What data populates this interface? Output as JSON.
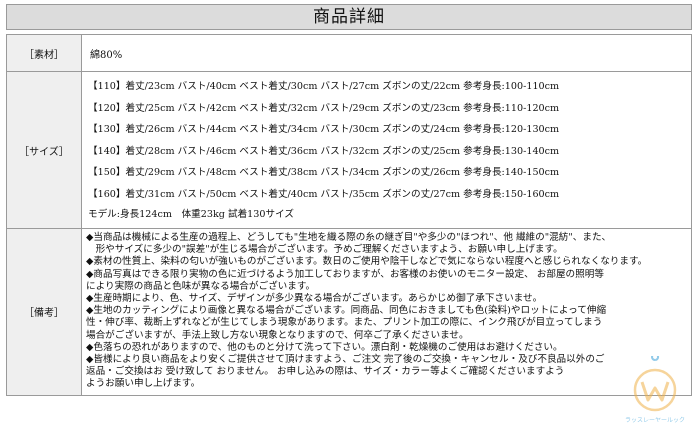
{
  "title": "商品詳細",
  "material": {
    "label": "［素材］",
    "value": "綿80%"
  },
  "sizes": {
    "label": "［サイズ］",
    "rows": [
      "【110】着丈/23cm バスト/40cm ベスト着丈/30cm バスト/27cm ズボンの丈/22cm 参考身長:100-110cm",
      "【120】着丈/25cm バスト/42cm ベスト着丈/32cm バスト/29cm ズボンの丈/23cm 参考身長:110-120cm",
      "【130】着丈/26cm バスト/44cm ベスト着丈/34cm バスト/30cm ズボンの丈/24cm 参考身長:120-130cm",
      "【140】着丈/28cm バスト/46cm ベスト着丈/36cm バスト/32cm ズボンの丈/25cm 参考身長:130-140cm",
      "【150】着丈/29cm バスト/48cm ベスト着丈/38cm バスト/34cm ズボンの丈/26cm 参考身長:140-150cm",
      "【160】着丈/31cm バスト/50cm ベスト着丈/40cm バスト/35cm ズボンの丈/27cm 参考身長:150-160cm"
    ],
    "model": "モデル:身長124cm　体重23kg 試着130サイズ"
  },
  "notes": {
    "label": "［備考］",
    "lines": [
      "◆当商品は機械による生産の過程上、どうしても\"生地を織る際の糸の継ぎ目\"や多少の\"ほつれ\"、他 繊維の\"混紡\"、また、",
      "　形やサイズに多少の\"誤差\"が生じる場合がございます。予めご理解くださいますよう、お願い申し上げます。",
      "◆素材の性質上、染料の匂いが強いものがございます。数日のご使用や陰干しなどで気にならない程度へと感じられなくなります。",
      "◆商品写真はできる限り実物の色に近づけるよう加工しておりますが、お客様のお使いのモニター設定、 お部屋の照明等",
      "により実際の商品と色味が異なる場合がございます。",
      "◆生産時期により、色、サイズ、デザインが多少異なる場合がございます。あらかじめ御了承下さいませ。",
      "◆生地のカッティングにより画像と異なる場合がございます。同商品、同色におきましても色(染料)やロットによって伸縮",
      "性・伸び率、裁断上ずれなどが生じてしまう現象があります。また、プリント加工の際に、インク飛びが目立ってしまう",
      "場合がございますが、手法上致し方ない現象となりますので、何卒ご了承くださいませ。",
      "◆色落ちの恐れがありますので、他のものと分けて洗って下さい。漂白剤・乾燥機のご使用はお避けください。",
      "◆皆様により良い商品をより安くご提供させて頂けますよう、ご注文 完了後のご交換・キャンセル・及び不良品以外のご",
      "返品・ご交換はお 受け致して おりません。 お申し込みの際は、サイズ・カラー等よくご確認くださいますよう",
      "ようお願い申し上げます。"
    ]
  },
  "watermark": {
    "text": "ラッスレーヤールック",
    "colors": {
      "ring": "#f0b24a",
      "accent": "#3aa0d8"
    }
  }
}
